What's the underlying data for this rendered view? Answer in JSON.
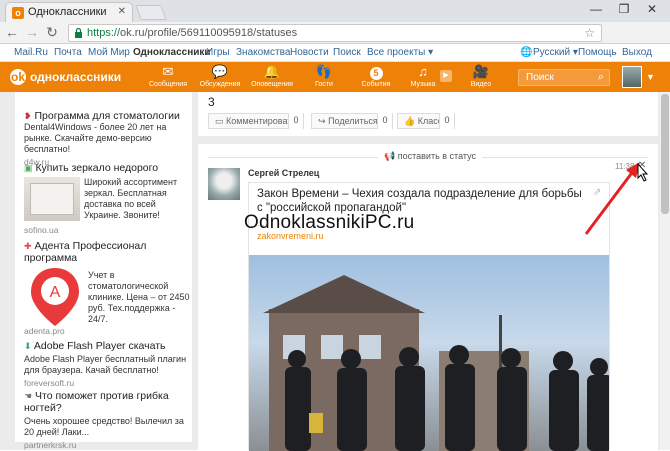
{
  "browser": {
    "tab_title": "Одноклассники",
    "tab_favicon": "ok-logo-icon",
    "url_secure": "https://",
    "url_rest": "ok.ru/profile/569110095918/statuses"
  },
  "top_links": {
    "mailru": "Mail.Ru",
    "mail": "Почта",
    "mymir": "Мой Мир",
    "ok": "Одноклассники",
    "games": "Игры",
    "dating": "Знакомства",
    "news": "Новости",
    "search": "Поиск",
    "all": "Все проекты ▾",
    "lang": "Русский ▾",
    "help": "Помощь",
    "exit": "Выход"
  },
  "nav": {
    "brand": "одноклассники",
    "items": [
      {
        "label": "Сообщения",
        "icon": "envelope-icon"
      },
      {
        "label": "Обсуждения",
        "icon": "chat-icon"
      },
      {
        "label": "Оповещения",
        "icon": "bell-icon"
      },
      {
        "label": "Гости",
        "icon": "footprints-icon"
      },
      {
        "label": "События",
        "icon": "events-icon",
        "badge": "5"
      },
      {
        "label": "Музыка",
        "icon": "music-icon"
      },
      {
        "label": "Видео",
        "icon": "video-icon"
      }
    ],
    "search_placeholder": "Поиск"
  },
  "ads": [
    {
      "title": "Программа для стоматологии",
      "desc": "Dental4Windows - более 20 лет на рынке. Скачайте демо-версию бесплатно!",
      "url": "d4w.ru"
    },
    {
      "title": "Купить зеркало недорого",
      "desc": "Широкий ассортимент зеркал. Бесплатная доставка по всей Украине. Звоните!",
      "url": "sofino.ua"
    },
    {
      "title": "Адента Профессионал программа",
      "desc": "Учет в стоматологической клинике. Цена – от 2450 руб. Тех.поддержка - 24/7.",
      "url": "adenta.pro"
    },
    {
      "title": "Adobe Flash Player скачать",
      "desc": "Adobe Flash Player бесплатный плагин для браузера. Качай бесплатно!",
      "url": "foreversoft.ru"
    },
    {
      "title": "Что поможет против грибка ногтей?",
      "desc": "Очень хорошее средство! Вылечил за 20 дней! Лаки...",
      "url": "partnerkrsk.ru"
    }
  ],
  "post1": {
    "number": "3",
    "comment": "Комментировать",
    "comment_count": "0",
    "share": "Поделиться",
    "share_count": "0",
    "like": "Класс",
    "like_count": "0"
  },
  "post2": {
    "header": "поставить в статус",
    "author": "Сергей Стрелец",
    "time": "11:38",
    "link_title": "Закон Времени – Чехия создала подразделение для борьбы с \"российской пропагандой\"",
    "link_desc": "...",
    "link_domain": "zakonvremeni.ru"
  },
  "watermark": "OdnoklassnikiPC.ru"
}
